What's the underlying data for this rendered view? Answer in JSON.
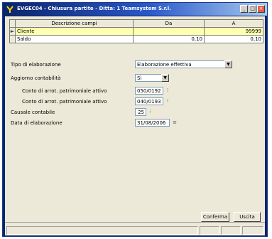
{
  "window": {
    "title": "EVGEC04 - Chiusura partite - Ditta: 1 Teamsystem S.r.l.",
    "controls": [
      "_",
      "□",
      "×"
    ]
  },
  "grid": {
    "headers": [
      "Descrizione campi",
      "Da",
      "A"
    ],
    "rows": [
      {
        "indicator": "►",
        "label": "Cliente",
        "da": "",
        "a": "99999"
      },
      {
        "indicator": "",
        "label": "Saldo",
        "da": "0,10",
        "a": "0,10"
      }
    ]
  },
  "form": {
    "tipo_elaborazione_label": "Tipo di elaborazione",
    "tipo_elaborazione_value": "Elaborazione effettiva",
    "aggiorno_label": "Aggiorno contabilità",
    "aggiorno_value": "Sì",
    "conto1_label": "Conto di arrot. patrimoniale attivo",
    "conto1_value": "050/0192",
    "conto2_label": "Conto di arrot. patrimoniale attivo",
    "conto2_value": "040/0193",
    "causale_label": "Causale contabile",
    "causale_value": "25",
    "data_label": "Data di elaborazione",
    "data_value": "31/08/2006"
  },
  "buttons": {
    "conferma": "Conferma",
    "uscita": "Uscita"
  },
  "colors": {
    "title_bar": "#0a246a",
    "selected_row": "#ffffb0",
    "dialog_bg": "#ece9d8"
  }
}
